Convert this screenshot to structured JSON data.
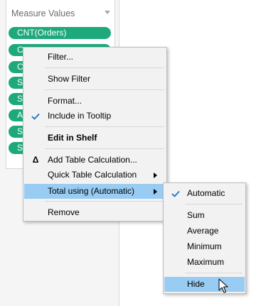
{
  "shelf": {
    "title": "Measure Values",
    "pills": [
      {
        "label": "CNT(Orders)"
      },
      {
        "label": "C"
      },
      {
        "label": "C"
      },
      {
        "label": "S"
      },
      {
        "label": "S"
      },
      {
        "label": "A"
      },
      {
        "label": "S"
      },
      {
        "label": "S"
      }
    ],
    "pill_color": "#1ea97c"
  },
  "context_menu": {
    "items": [
      {
        "label": "Filter..."
      },
      {
        "label": "Show Filter"
      },
      {
        "label": "Format..."
      },
      {
        "label": "Include in Tooltip",
        "checked": true
      },
      {
        "label": "Edit in Shelf"
      },
      {
        "label": "Add Table Calculation...",
        "icon": "delta-icon",
        "icon_glyph": "Δ"
      },
      {
        "label": "Quick Table Calculation",
        "submenu": true
      },
      {
        "label": "Total using (Automatic)",
        "submenu": true,
        "highlighted": true
      },
      {
        "label": "Remove"
      }
    ]
  },
  "submenu": {
    "items": [
      {
        "label": "Automatic",
        "checked": true
      },
      {
        "label": "Sum"
      },
      {
        "label": "Average"
      },
      {
        "label": "Minimum"
      },
      {
        "label": "Maximum"
      },
      {
        "label": "Hide",
        "highlighted": true
      }
    ]
  },
  "colors": {
    "highlight": "#99ccf3",
    "check": "#1e6fc7",
    "menu_bg": "#f2f2f2"
  }
}
